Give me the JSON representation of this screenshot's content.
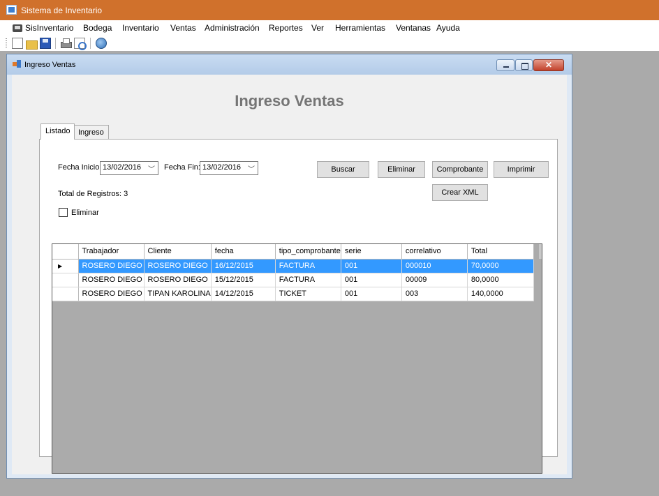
{
  "app": {
    "title": "Sistema de Inventario"
  },
  "menu": {
    "items": [
      "SisInventario",
      "Bodega",
      "Inventario",
      "Ventas",
      "Administración",
      "Reportes",
      "Ver",
      "Herramientas",
      "Ventanas",
      "Ayuda"
    ]
  },
  "toolbar": {
    "icons": [
      "new-document-icon",
      "open-folder-icon",
      "save-icon",
      "print-icon",
      "print-preview-icon",
      "help-icon"
    ]
  },
  "window": {
    "title": "Ingreso Ventas"
  },
  "form": {
    "heading": "Ingreso Ventas",
    "tabs": [
      "Listado",
      "Ingreso"
    ],
    "fecha_inicio_label": "Fecha Inicio:",
    "fecha_inicio_value": "13/02/2016",
    "fecha_fin_label": "Fecha Fin:",
    "fecha_fin_value": "13/02/2016",
    "buttons": {
      "buscar": "Buscar",
      "eliminar": "Eliminar",
      "comprobante": "Comprobante",
      "imprimir": "Imprimir",
      "crear_xml": "Crear XML"
    },
    "total_registros": "Total de Registros: 3",
    "eliminar_checkbox": "Eliminar"
  },
  "grid": {
    "columns": [
      "Trabajador",
      "Cliente",
      "fecha",
      "tipo_comprobante",
      "serie",
      "correlativo",
      "Total"
    ],
    "rows": [
      [
        "ROSERO DIEGO",
        "ROSERO DIEGO",
        "16/12/2015",
        "FACTURA",
        "001",
        "000010",
        "70,0000"
      ],
      [
        "ROSERO DIEGO",
        "ROSERO DIEGO",
        "15/12/2015",
        "FACTURA",
        "001",
        "00009",
        "80,0000"
      ],
      [
        "ROSERO DIEGO",
        "TIPAN KAROLINA",
        "14/12/2015",
        "TICKET",
        "001",
        "003",
        "140,0000"
      ]
    ],
    "selected_row": 0
  },
  "colors": {
    "title_bar": "#d0712c",
    "selection": "#3399ff",
    "mdi_background": "#aaaaaa",
    "heading_text": "#757575"
  }
}
